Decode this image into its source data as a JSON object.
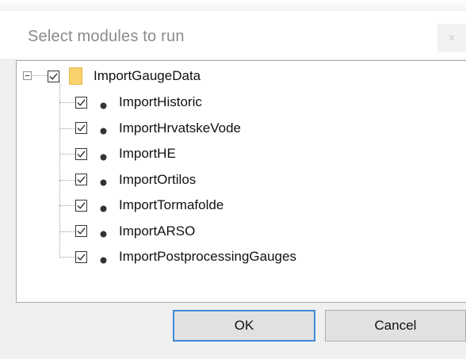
{
  "dialog": {
    "title": "Select modules to run",
    "close_glyph": "x"
  },
  "tree": {
    "root": {
      "label": "ImportGaugeData",
      "checked": true,
      "expanded": true,
      "icon": "folder-icon"
    },
    "children": [
      {
        "label": "ImportHistoric",
        "checked": true,
        "icon": "module-dot-icon"
      },
      {
        "label": "ImportHrvatskeVode",
        "checked": true,
        "icon": "module-dot-icon"
      },
      {
        "label": "ImportHE",
        "checked": true,
        "icon": "module-dot-icon"
      },
      {
        "label": "ImportOrtilos",
        "checked": true,
        "icon": "module-dot-icon"
      },
      {
        "label": "ImportTormafolde",
        "checked": true,
        "icon": "module-dot-icon"
      },
      {
        "label": "ImportARSO",
        "checked": true,
        "icon": "module-dot-icon"
      },
      {
        "label": "ImportPostprocessingGauges",
        "checked": true,
        "icon": "module-dot-icon"
      }
    ]
  },
  "buttons": {
    "ok_label": "OK",
    "cancel_label": "Cancel"
  },
  "colors": {
    "folder": "#f9d26e",
    "ok_focus_border": "#3c8ad6",
    "title_text": "#8a8a8a"
  }
}
